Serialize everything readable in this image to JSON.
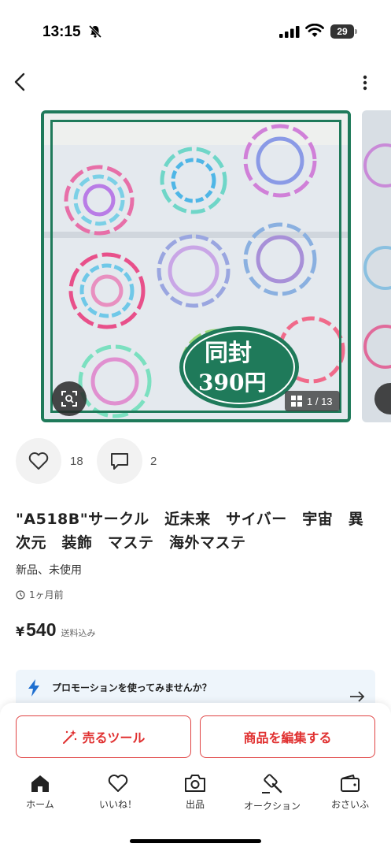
{
  "status_bar": {
    "time": "13:15",
    "battery": "29"
  },
  "product": {
    "image_counter": "1 / 13",
    "badge_line1": "同封",
    "badge_line2": "390円",
    "likes": "18",
    "comments": "2",
    "title": "\"A518B\"サークル　近未来　サイバー　宇宙　異次元　装飾　マステ　海外マステ",
    "condition": "新品、未使用",
    "listed": "1ヶ月前",
    "currency": "¥",
    "price": "540",
    "shipping": "送料込み"
  },
  "promo": {
    "text": "プロモーションを使ってみませんか？"
  },
  "actions": {
    "sell_tool": "売るツール",
    "edit_item": "商品を編集する"
  },
  "tabs": [
    {
      "label": "ホーム",
      "icon": "home-icon"
    },
    {
      "label": "いいね！",
      "icon": "heart-icon"
    },
    {
      "label": "出品",
      "icon": "camera-icon"
    },
    {
      "label": "オークション",
      "icon": "gavel-icon"
    },
    {
      "label": "おさいふ",
      "icon": "wallet-icon"
    }
  ],
  "colors": {
    "accent_red": "#e03030",
    "frame_green": "#1f7a5a",
    "promo_blue": "#1e6fd0"
  }
}
